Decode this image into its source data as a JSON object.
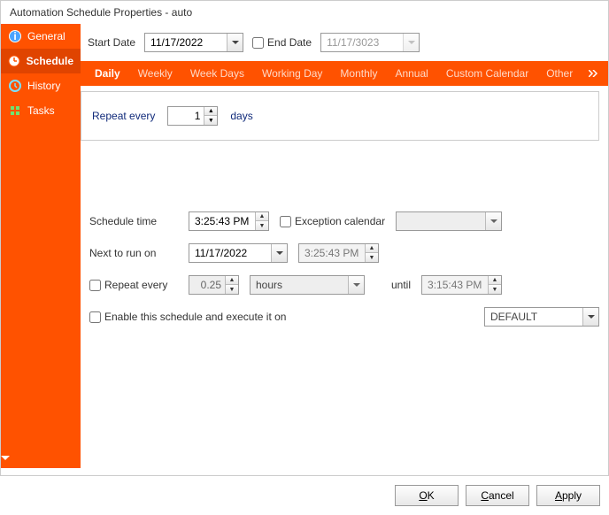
{
  "title": "Automation Schedule Properties - auto",
  "sidebar": {
    "items": [
      {
        "label": "General"
      },
      {
        "label": "Schedule"
      },
      {
        "label": "History"
      },
      {
        "label": "Tasks"
      }
    ]
  },
  "dates": {
    "start_label": "Start Date",
    "start_value": "11/17/2022",
    "end_checkbox_label": "End Date",
    "end_value": "11/17/3023"
  },
  "tabs": [
    "Daily",
    "Weekly",
    "Week Days",
    "Working Day",
    "Monthly",
    "Annual",
    "Custom Calendar",
    "Other"
  ],
  "daily": {
    "repeat_label": "Repeat every",
    "repeat_value": "1",
    "repeat_unit": "days"
  },
  "schedule": {
    "time_label": "Schedule time",
    "time_value": "3:25:43 PM",
    "exception_label": "Exception calendar",
    "exception_value": "",
    "next_label": "Next to run on",
    "next_date": "11/17/2022",
    "next_time": "3:25:43 PM",
    "repeat2_label": "Repeat every",
    "repeat2_value": "0.25",
    "repeat2_unit": "hours",
    "until_label": "until",
    "until_time": "3:15:43 PM",
    "enable_label": "Enable this schedule and execute it on",
    "target_value": "DEFAULT"
  },
  "buttons": {
    "ok": "OK",
    "cancel": "Cancel",
    "apply": "Apply"
  }
}
